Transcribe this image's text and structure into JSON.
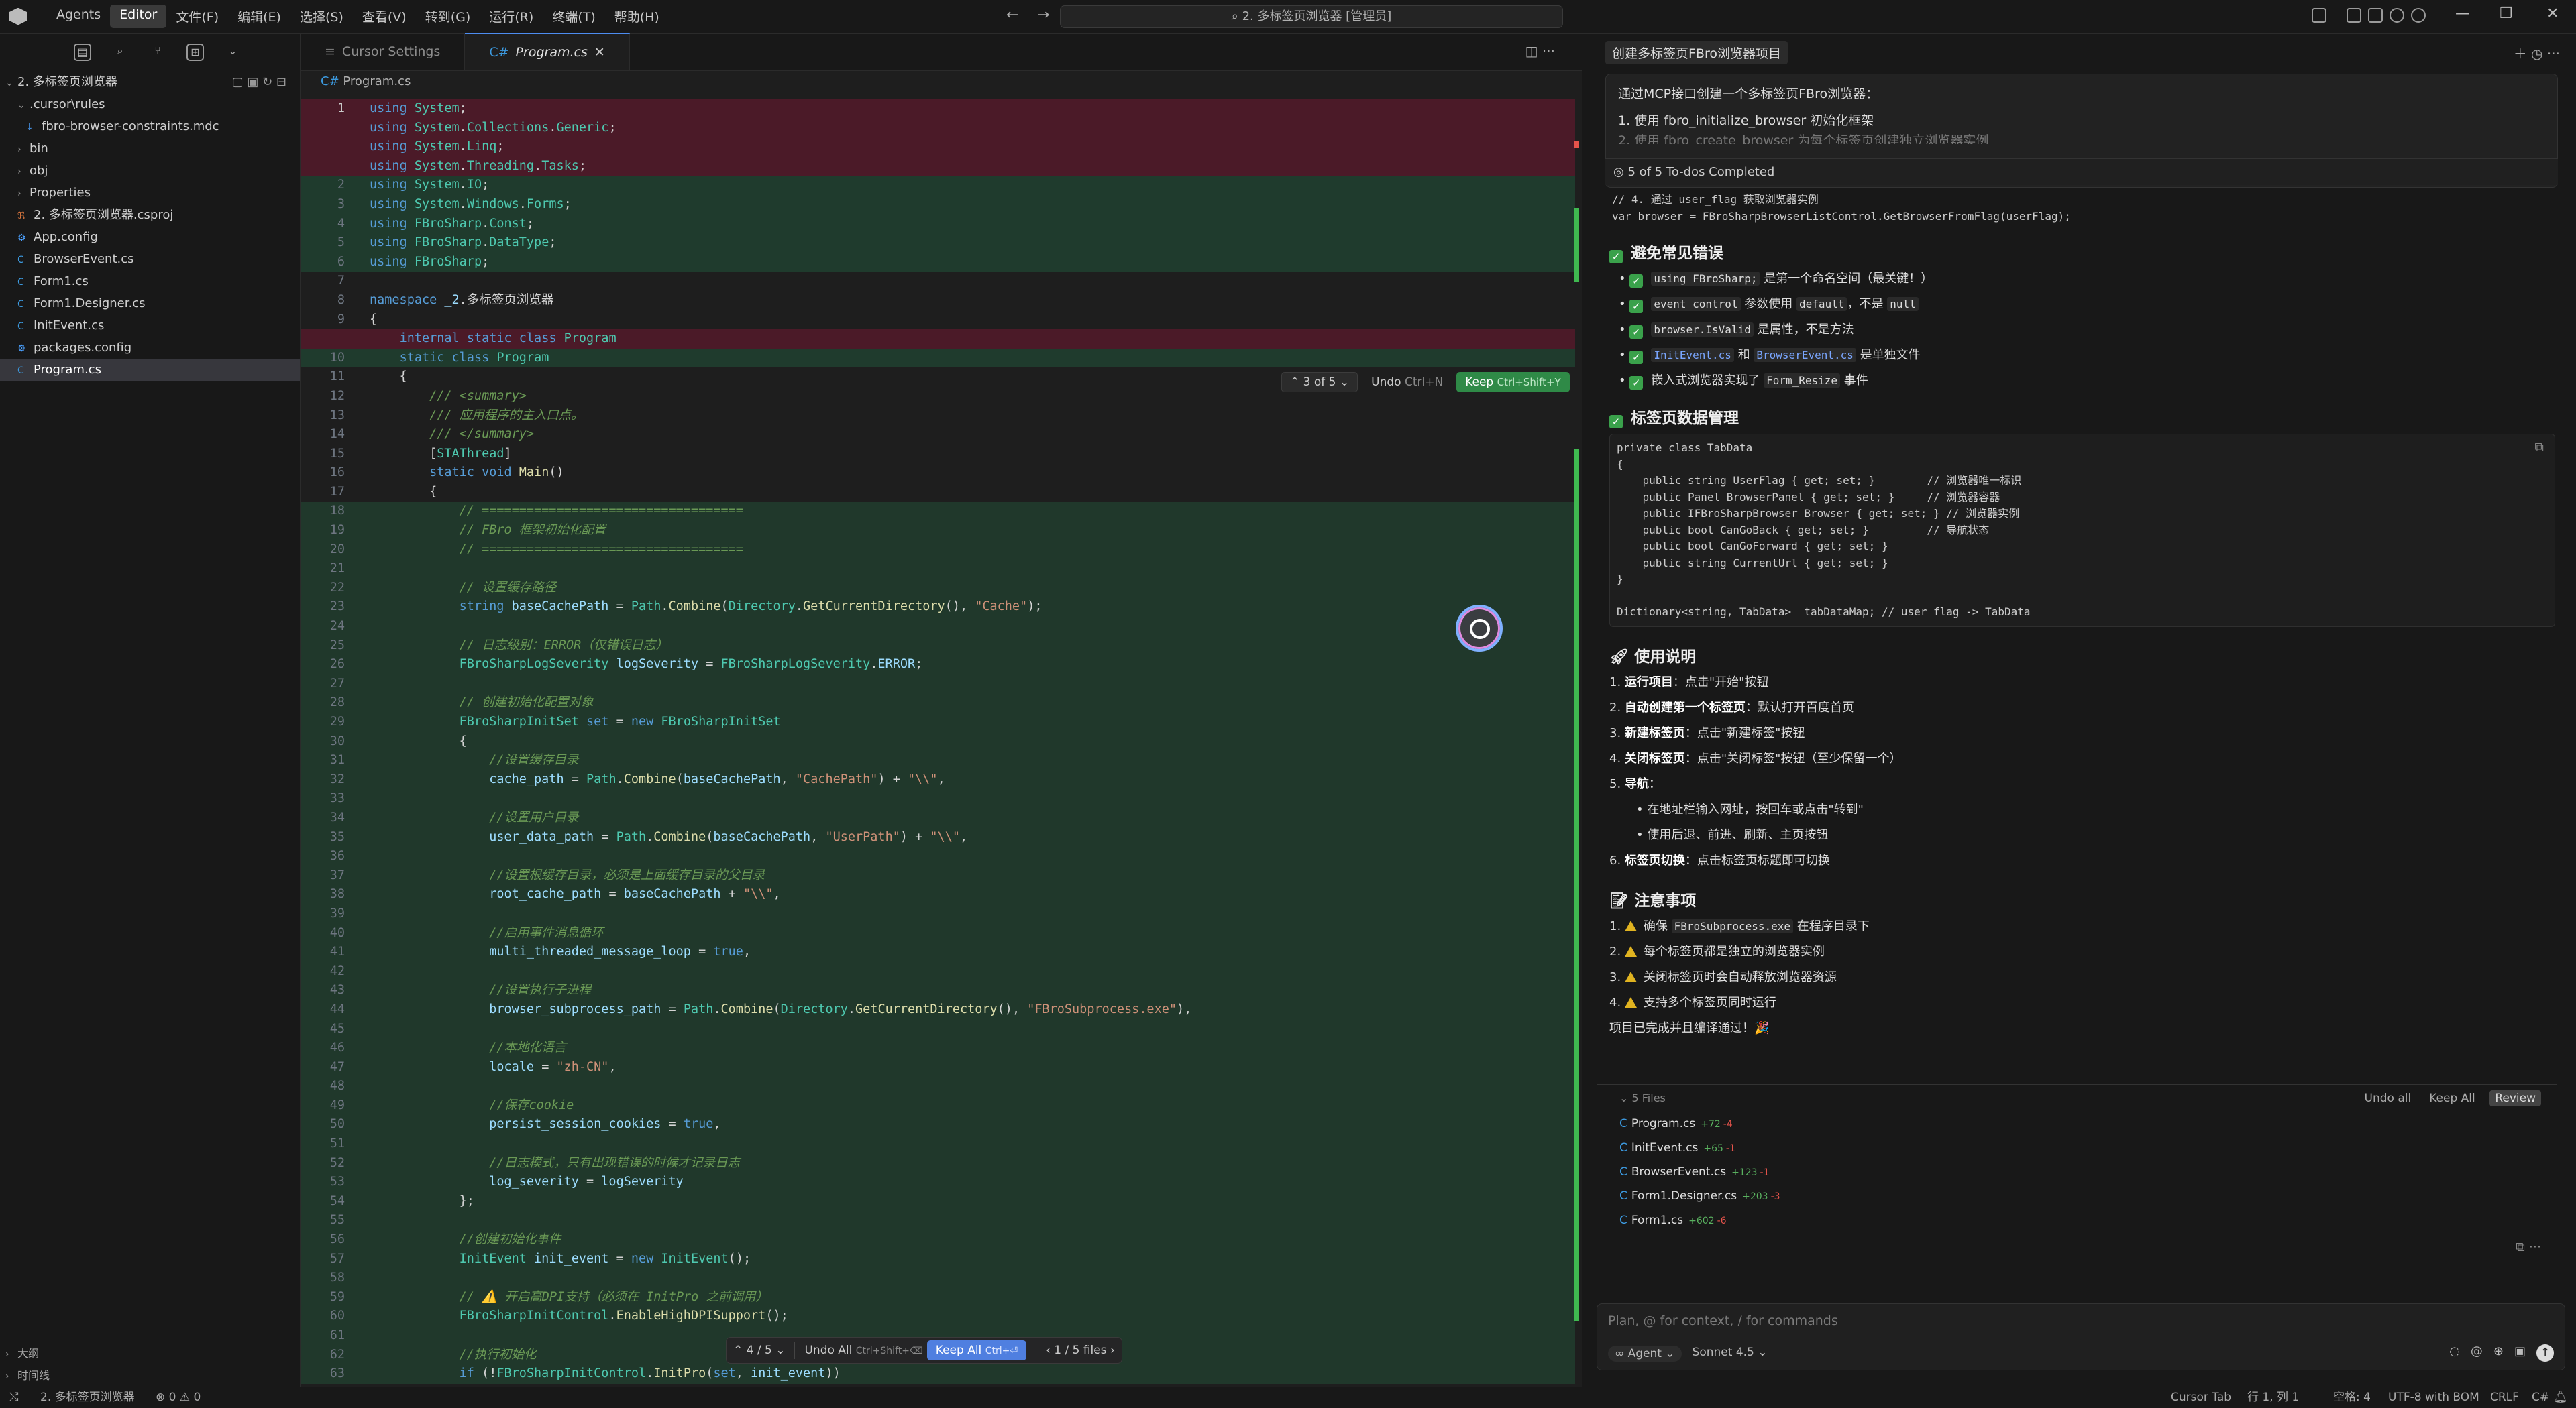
{
  "titlebar": {
    "menu": [
      "Agents",
      "Editor",
      "文件(F)",
      "编辑(E)",
      "选择(S)",
      "查看(V)",
      "转到(G)",
      "运行(R)",
      "终端(T)",
      "帮助(H)"
    ],
    "search_text": "2. 多标签页浏览器 [管理员]"
  },
  "sidebar": {
    "project_title": "2. 多标签页浏览器",
    "tree": [
      {
        "label": ".cursor\\rules",
        "type": "folder-open",
        "depth": 1
      },
      {
        "label": "fbro-browser-constraints.mdc",
        "type": "mdc",
        "depth": 2
      },
      {
        "label": "bin",
        "type": "folder",
        "depth": 1
      },
      {
        "label": "obj",
        "type": "folder",
        "depth": 1
      },
      {
        "label": "Properties",
        "type": "folder",
        "depth": 1
      },
      {
        "label": "2. 多标签页浏览器.csproj",
        "type": "csproj",
        "depth": 1
      },
      {
        "label": "App.config",
        "type": "config",
        "depth": 1
      },
      {
        "label": "BrowserEvent.cs",
        "type": "cs",
        "depth": 1
      },
      {
        "label": "Form1.cs",
        "type": "cs",
        "depth": 1
      },
      {
        "label": "Form1.Designer.cs",
        "type": "cs",
        "depth": 1
      },
      {
        "label": "InitEvent.cs",
        "type": "cs",
        "depth": 1
      },
      {
        "label": "packages.config",
        "type": "config",
        "depth": 1
      },
      {
        "label": "Program.cs",
        "type": "cs",
        "depth": 1,
        "selected": true
      }
    ],
    "outline_label": "大纲",
    "timeline_label": "时间线"
  },
  "editor": {
    "tabs": [
      {
        "label": "Cursor Settings",
        "active": false
      },
      {
        "label": "Program.cs",
        "active": true
      }
    ],
    "breadcrumb": "Program.cs",
    "inline_bar": {
      "counter": "3 of 5",
      "undo": "Undo",
      "undo_key": "Ctrl+N",
      "keep": "Keep",
      "keep_key": "Ctrl+Shift+Y"
    },
    "bottom_bar": {
      "counter": "4 / 5",
      "undo_all": "Undo All",
      "undo_all_key": "Ctrl+Shift+⌫",
      "keep_all": "Keep All",
      "keep_all_key": "Ctrl+⏎",
      "files": "1 / 5 files"
    },
    "code_lines": [
      {
        "n": "1",
        "t": "using System;",
        "k": "del"
      },
      {
        "n": "",
        "t": "using System.Collections.Generic;",
        "k": "del"
      },
      {
        "n": "",
        "t": "using System.Linq;",
        "k": "del"
      },
      {
        "n": "",
        "t": "using System.Threading.Tasks;",
        "k": "del"
      },
      {
        "n": "2",
        "t": "using System.IO;",
        "k": "add"
      },
      {
        "n": "3",
        "t": "using System.Windows.Forms;",
        "k": "add"
      },
      {
        "n": "4",
        "t": "using FBroSharp.Const;",
        "k": "add"
      },
      {
        "n": "5",
        "t": "using FBroSharp.DataType;",
        "k": "add"
      },
      {
        "n": "6",
        "t": "using FBroSharp;",
        "k": "add"
      },
      {
        "n": "7",
        "t": "",
        "k": ""
      },
      {
        "n": "8",
        "t": "namespace _2.多标签页浏览器",
        "k": ""
      },
      {
        "n": "9",
        "t": "{",
        "k": ""
      },
      {
        "n": "",
        "t": "    internal static class Program",
        "k": "del"
      },
      {
        "n": "10",
        "t": "    static class Program",
        "k": "add"
      },
      {
        "n": "11",
        "t": "    {",
        "k": ""
      },
      {
        "n": "12",
        "t": "        /// <summary>",
        "k": ""
      },
      {
        "n": "13",
        "t": "        /// 应用程序的主入口点。",
        "k": ""
      },
      {
        "n": "14",
        "t": "        /// </summary>",
        "k": ""
      },
      {
        "n": "15",
        "t": "        [STAThread]",
        "k": ""
      },
      {
        "n": "16",
        "t": "        static void Main()",
        "k": ""
      },
      {
        "n": "17",
        "t": "        {",
        "k": ""
      },
      {
        "n": "18",
        "t": "            // ===================================",
        "k": "addm"
      },
      {
        "n": "19",
        "t": "            // FBro 框架初始化配置",
        "k": "addm"
      },
      {
        "n": "20",
        "t": "            // ===================================",
        "k": "addm"
      },
      {
        "n": "21",
        "t": "",
        "k": "addm"
      },
      {
        "n": "22",
        "t": "            // 设置缓存路径",
        "k": "addm"
      },
      {
        "n": "23",
        "t": "            string baseCachePath = Path.Combine(Directory.GetCurrentDirectory(), \"Cache\");",
        "k": "addm"
      },
      {
        "n": "24",
        "t": "",
        "k": "addm"
      },
      {
        "n": "25",
        "t": "            // 日志级别：ERROR（仅错误日志）",
        "k": "addm"
      },
      {
        "n": "26",
        "t": "            FBroSharpLogSeverity logSeverity = FBroSharpLogSeverity.ERROR;",
        "k": "addm"
      },
      {
        "n": "27",
        "t": "",
        "k": "addm"
      },
      {
        "n": "28",
        "t": "            // 创建初始化配置对象",
        "k": "addm"
      },
      {
        "n": "29",
        "t": "            FBroSharpInitSet set = new FBroSharpInitSet",
        "k": "addm"
      },
      {
        "n": "30",
        "t": "            {",
        "k": "addm"
      },
      {
        "n": "31",
        "t": "                //设置缓存目录",
        "k": "addm"
      },
      {
        "n": "32",
        "t": "                cache_path = Path.Combine(baseCachePath, \"CachePath\") + \"\\\\\",",
        "k": "addm"
      },
      {
        "n": "33",
        "t": "",
        "k": "addm"
      },
      {
        "n": "34",
        "t": "                //设置用户目录",
        "k": "addm"
      },
      {
        "n": "35",
        "t": "                user_data_path = Path.Combine(baseCachePath, \"UserPath\") + \"\\\\\",",
        "k": "addm"
      },
      {
        "n": "36",
        "t": "",
        "k": "addm"
      },
      {
        "n": "37",
        "t": "                //设置根缓存目录，必须是上面缓存目录的父目录",
        "k": "addm"
      },
      {
        "n": "38",
        "t": "                root_cache_path = baseCachePath + \"\\\\\",",
        "k": "addm"
      },
      {
        "n": "39",
        "t": "",
        "k": "addm"
      },
      {
        "n": "40",
        "t": "                //启用事件消息循环",
        "k": "addm"
      },
      {
        "n": "41",
        "t": "                multi_threaded_message_loop = true,",
        "k": "addm"
      },
      {
        "n": "42",
        "t": "",
        "k": "addm"
      },
      {
        "n": "43",
        "t": "                //设置执行子进程",
        "k": "addm"
      },
      {
        "n": "44",
        "t": "                browser_subprocess_path = Path.Combine(Directory.GetCurrentDirectory(), \"FBroSubprocess.exe\"),",
        "k": "addm"
      },
      {
        "n": "45",
        "t": "",
        "k": "addm"
      },
      {
        "n": "46",
        "t": "                //本地化语言",
        "k": "addm"
      },
      {
        "n": "47",
        "t": "                locale = \"zh-CN\",",
        "k": "addm"
      },
      {
        "n": "48",
        "t": "",
        "k": "addm"
      },
      {
        "n": "49",
        "t": "                //保存cookie",
        "k": "addm"
      },
      {
        "n": "50",
        "t": "                persist_session_cookies = true,",
        "k": "addm"
      },
      {
        "n": "51",
        "t": "",
        "k": "addm"
      },
      {
        "n": "52",
        "t": "                //日志模式，只有出现错误的时候才记录日志",
        "k": "addm"
      },
      {
        "n": "53",
        "t": "                log_severity = logSeverity",
        "k": "addm"
      },
      {
        "n": "54",
        "t": "            };",
        "k": "addm"
      },
      {
        "n": "55",
        "t": "",
        "k": "addm"
      },
      {
        "n": "56",
        "t": "            //创建初始化事件",
        "k": "addm"
      },
      {
        "n": "57",
        "t": "            InitEvent init_event = new InitEvent();",
        "k": "addm"
      },
      {
        "n": "58",
        "t": "",
        "k": "addm"
      },
      {
        "n": "59",
        "t": "            // ⚠️ 开启高DPI支持（必须在 InitPro 之前调用）",
        "k": "addm"
      },
      {
        "n": "60",
        "t": "            FBroSharpInitControl.EnableHighDPISupport();",
        "k": "addm"
      },
      {
        "n": "61",
        "t": "",
        "k": "addm"
      },
      {
        "n": "62",
        "t": "            //执行初始化",
        "k": "addm"
      },
      {
        "n": "63",
        "t": "            if (!FBroSharpInitControl.InitPro(set, init_event))",
        "k": "addm"
      }
    ]
  },
  "chat": {
    "title": "创建多标签页FBro浏览器项目",
    "user_msg_line1": "通过MCP接口创建一个多标签页FBro浏览器：",
    "user_msg_line2": "1. 使用 fbro_initialize_browser 初始化框架",
    "user_msg_line3": "2. 使用 fbro_create_browser 为每个标签页创建独立浏览器实例",
    "todos": "5 of 5 To-dos Completed",
    "code_top": [
      "// 4. 通过 user_flag 获取浏览器实例",
      "var browser = FBroSharpBrowserListControl.GetBrowserFromFlag(userFlag);"
    ],
    "h_errors": "避免常见错误",
    "errors": [
      {
        "pre": "",
        "code": "using FBroSharp;",
        "post": " 是第一个命名空间（最关键！）",
        "blue": false
      },
      {
        "pre": "",
        "code": "event_control",
        "post": " 参数使用 ",
        "code2": "default",
        "post2": "，不是 ",
        "code3": "null",
        "blue": false
      },
      {
        "pre": "",
        "code": "browser.IsValid",
        "post": " 是属性，不是方法",
        "blue": false
      },
      {
        "pre": "",
        "code": "InitEvent.cs",
        "post": " 和 ",
        "code2": "BrowserEvent.cs",
        "post2": " 是单独文件",
        "blue": true
      },
      {
        "pre": "嵌入式浏览器实现了 ",
        "code": "Form_Resize",
        "post": " 事件",
        "blue": false
      }
    ],
    "h_tabs": "标签页数据管理",
    "tab_code": [
      "private class TabData",
      "{",
      "    public string UserFlag { get; set; }        // 浏览器唯一标识",
      "    public Panel BrowserPanel { get; set; }     // 浏览器容器",
      "    public IFBroSharpBrowser Browser { get; set; } // 浏览器实例",
      "    public bool CanGoBack { get; set; }         // 导航状态",
      "    public bool CanGoForward { get; set; }",
      "    public string CurrentUrl { get; set; }",
      "}",
      "",
      "Dictionary<string, TabData> _tabDataMap; // user_flag -> TabData"
    ],
    "h_usage": "使用说明",
    "usage": [
      {
        "b": "运行项目",
        "t": "：点击\"开始\"按钮"
      },
      {
        "b": "自动创建第一个标签页",
        "t": "：默认打开百度首页"
      },
      {
        "b": "新建标签页",
        "t": "：点击\"新建标签\"按钮"
      },
      {
        "b": "关闭标签页",
        "t": "：点击\"关闭标签\"按钮（至少保留一个）"
      },
      {
        "b": "导航",
        "t": "："
      }
    ],
    "usage_sub": [
      "在地址栏输入网址，按回车或点击\"转到\"",
      "使用后退、前进、刷新、主页按钮"
    ],
    "usage6": {
      "b": "标签页切换",
      "t": "：点击标签页标题即可切换"
    },
    "h_notes": "注意事项",
    "notes_pre": "确保 ",
    "notes_code": "FBroSubprocess.exe",
    "notes_post": " 在程序目录下",
    "notes": [
      "每个标签页都是独立的浏览器实例",
      "关闭标签页时会自动释放浏览器资源",
      "支持多个标签页同时运行"
    ],
    "done": "项目已完成并且编译通过！🎉",
    "files_count": "5 Files",
    "undo_all": "Undo all",
    "keep_all": "Keep All",
    "review": "Review",
    "files": [
      {
        "name": "Program.cs",
        "plus": "+72",
        "minus": "-4"
      },
      {
        "name": "InitEvent.cs",
        "plus": "+65",
        "minus": "-1"
      },
      {
        "name": "BrowserEvent.cs",
        "plus": "+123",
        "minus": "-1"
      },
      {
        "name": "Form1.Designer.cs",
        "plus": "+203",
        "minus": "-3"
      },
      {
        "name": "Form1.cs",
        "plus": "+602",
        "minus": "-6"
      }
    ],
    "input_placeholder": "Plan, @ for context, / for commands",
    "agent_label": "Agent",
    "model_label": "Sonnet 4.5"
  },
  "status": {
    "branch": "2. 多标签页浏览器",
    "problems": "⊗ 0  ⚠ 0",
    "cursor_tab": "Cursor Tab",
    "position": "行 1, 列 1",
    "spaces": "空格: 4",
    "encoding": "UTF-8 with BOM",
    "eol": "CRLF",
    "lang": "C#"
  },
  "colors": {
    "accent": "#4f7fe0",
    "keep_green": "#2f8a47",
    "added_bg": "#1f3b2d",
    "removed_bg": "#4b1a28"
  }
}
